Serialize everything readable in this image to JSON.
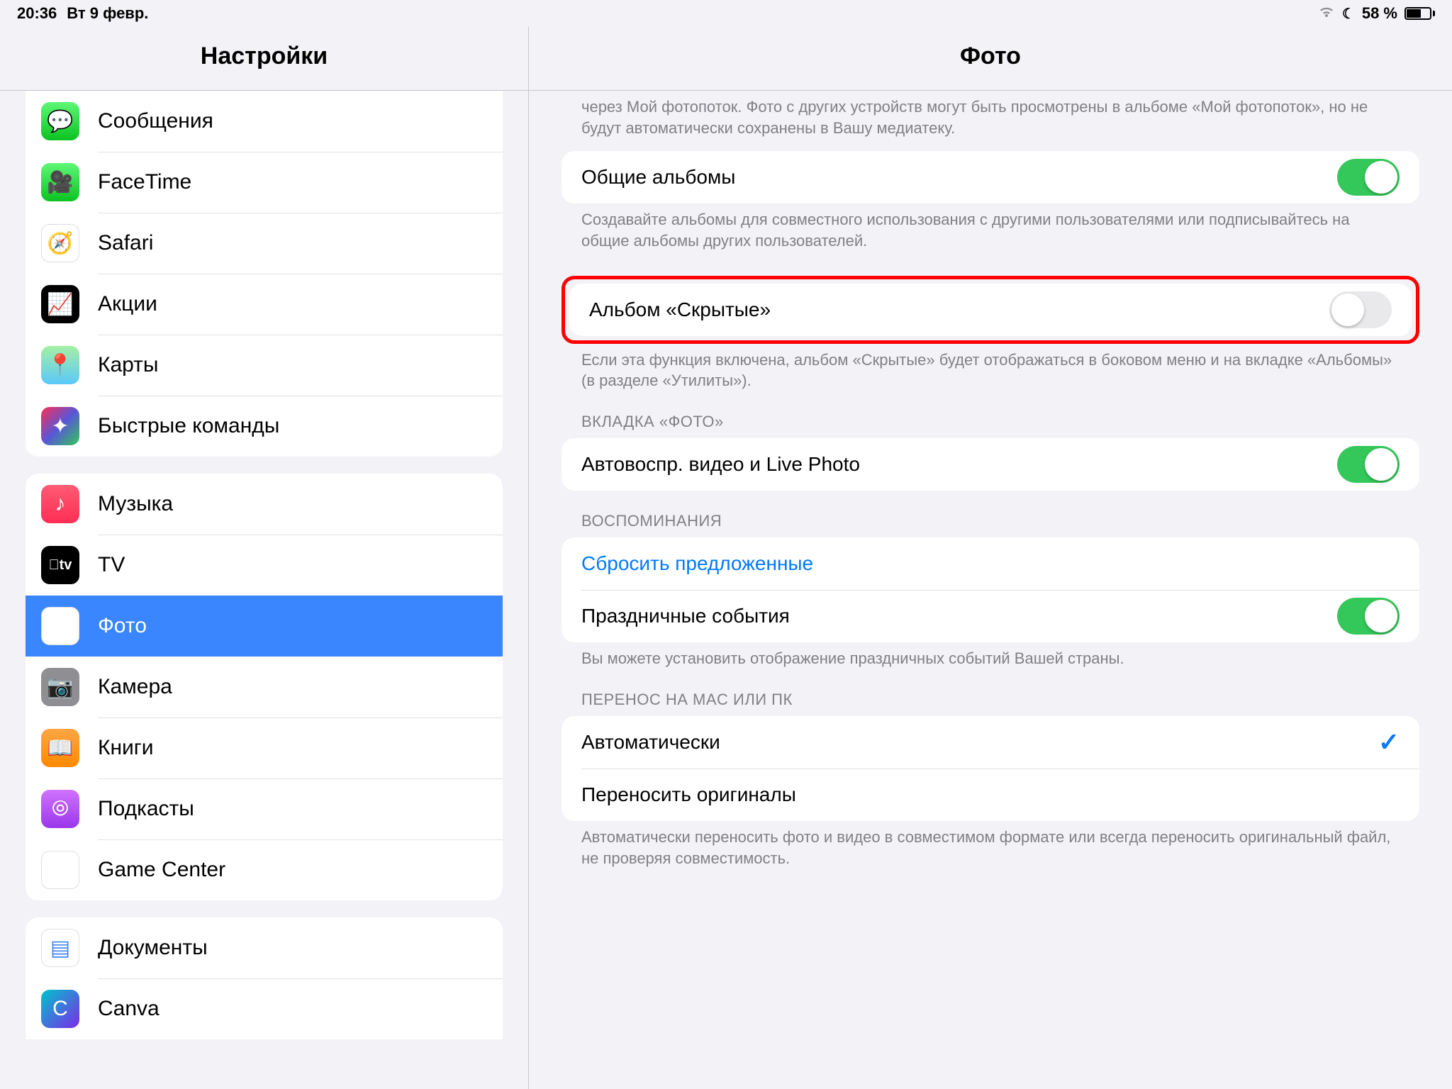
{
  "statusbar": {
    "time": "20:36",
    "date": "Вт 9 февр.",
    "battery_text": "58 %",
    "battery_level": 58
  },
  "sidebar": {
    "title": "Настройки",
    "group_apps1": [
      {
        "label": "Сообщения",
        "icon": "messages"
      },
      {
        "label": "FaceTime",
        "icon": "facetime"
      },
      {
        "label": "Safari",
        "icon": "safari"
      },
      {
        "label": "Акции",
        "icon": "stocks"
      },
      {
        "label": "Карты",
        "icon": "maps"
      },
      {
        "label": "Быстрые команды",
        "icon": "shortcuts"
      }
    ],
    "group_apps2": [
      {
        "label": "Музыка",
        "icon": "music"
      },
      {
        "label": "TV",
        "icon": "tv"
      },
      {
        "label": "Фото",
        "icon": "photos",
        "selected": true
      },
      {
        "label": "Камера",
        "icon": "camera"
      },
      {
        "label": "Книги",
        "icon": "books"
      },
      {
        "label": "Подкасты",
        "icon": "podcasts"
      },
      {
        "label": "Game Center",
        "icon": "gamecenter"
      }
    ],
    "group_apps3": [
      {
        "label": "Документы",
        "icon": "docs"
      },
      {
        "label": "Canva",
        "icon": "canva"
      }
    ]
  },
  "detail": {
    "title": "Фото",
    "photostream_footer": "через Мой фотопоток. Фото с других устройств могут быть просмотрены в альбоме «Мой фотопоток», но не будут автоматически сохранены в Вашу медиатеку.",
    "shared_albums": {
      "label": "Общие альбомы",
      "on": true
    },
    "shared_albums_footer": "Создавайте альбомы для совместного использования с другими пользователями или подписывайтесь на общие альбомы других пользователей.",
    "hidden_album": {
      "label": "Альбом «Скрытые»",
      "on": false
    },
    "hidden_album_footer": "Если эта функция включена, альбом «Скрытые» будет отображаться в боковом меню и на вкладке «Альбомы» (в разделе «Утилиты»).",
    "tab_header": "ВКЛАДКА «ФОТО»",
    "autoplay": {
      "label": "Автовоспр. видео и Live Photo",
      "on": true
    },
    "memories_header": "ВОСПОМИНАНИЯ",
    "reset_suggested": "Сбросить предложенные",
    "holiday_events": {
      "label": "Праздничные события",
      "on": true
    },
    "memories_footer": "Вы можете установить отображение праздничных событий Вашей страны.",
    "transfer_header": "ПЕРЕНОС НА MAC ИЛИ ПК",
    "transfer_auto": "Автоматически",
    "transfer_orig": "Переносить оригиналы",
    "transfer_selected": "auto",
    "transfer_footer": "Автоматически переносить фото и видео в совместимом формате или всегда переносить оригинальный файл, не проверяя совместимость."
  }
}
